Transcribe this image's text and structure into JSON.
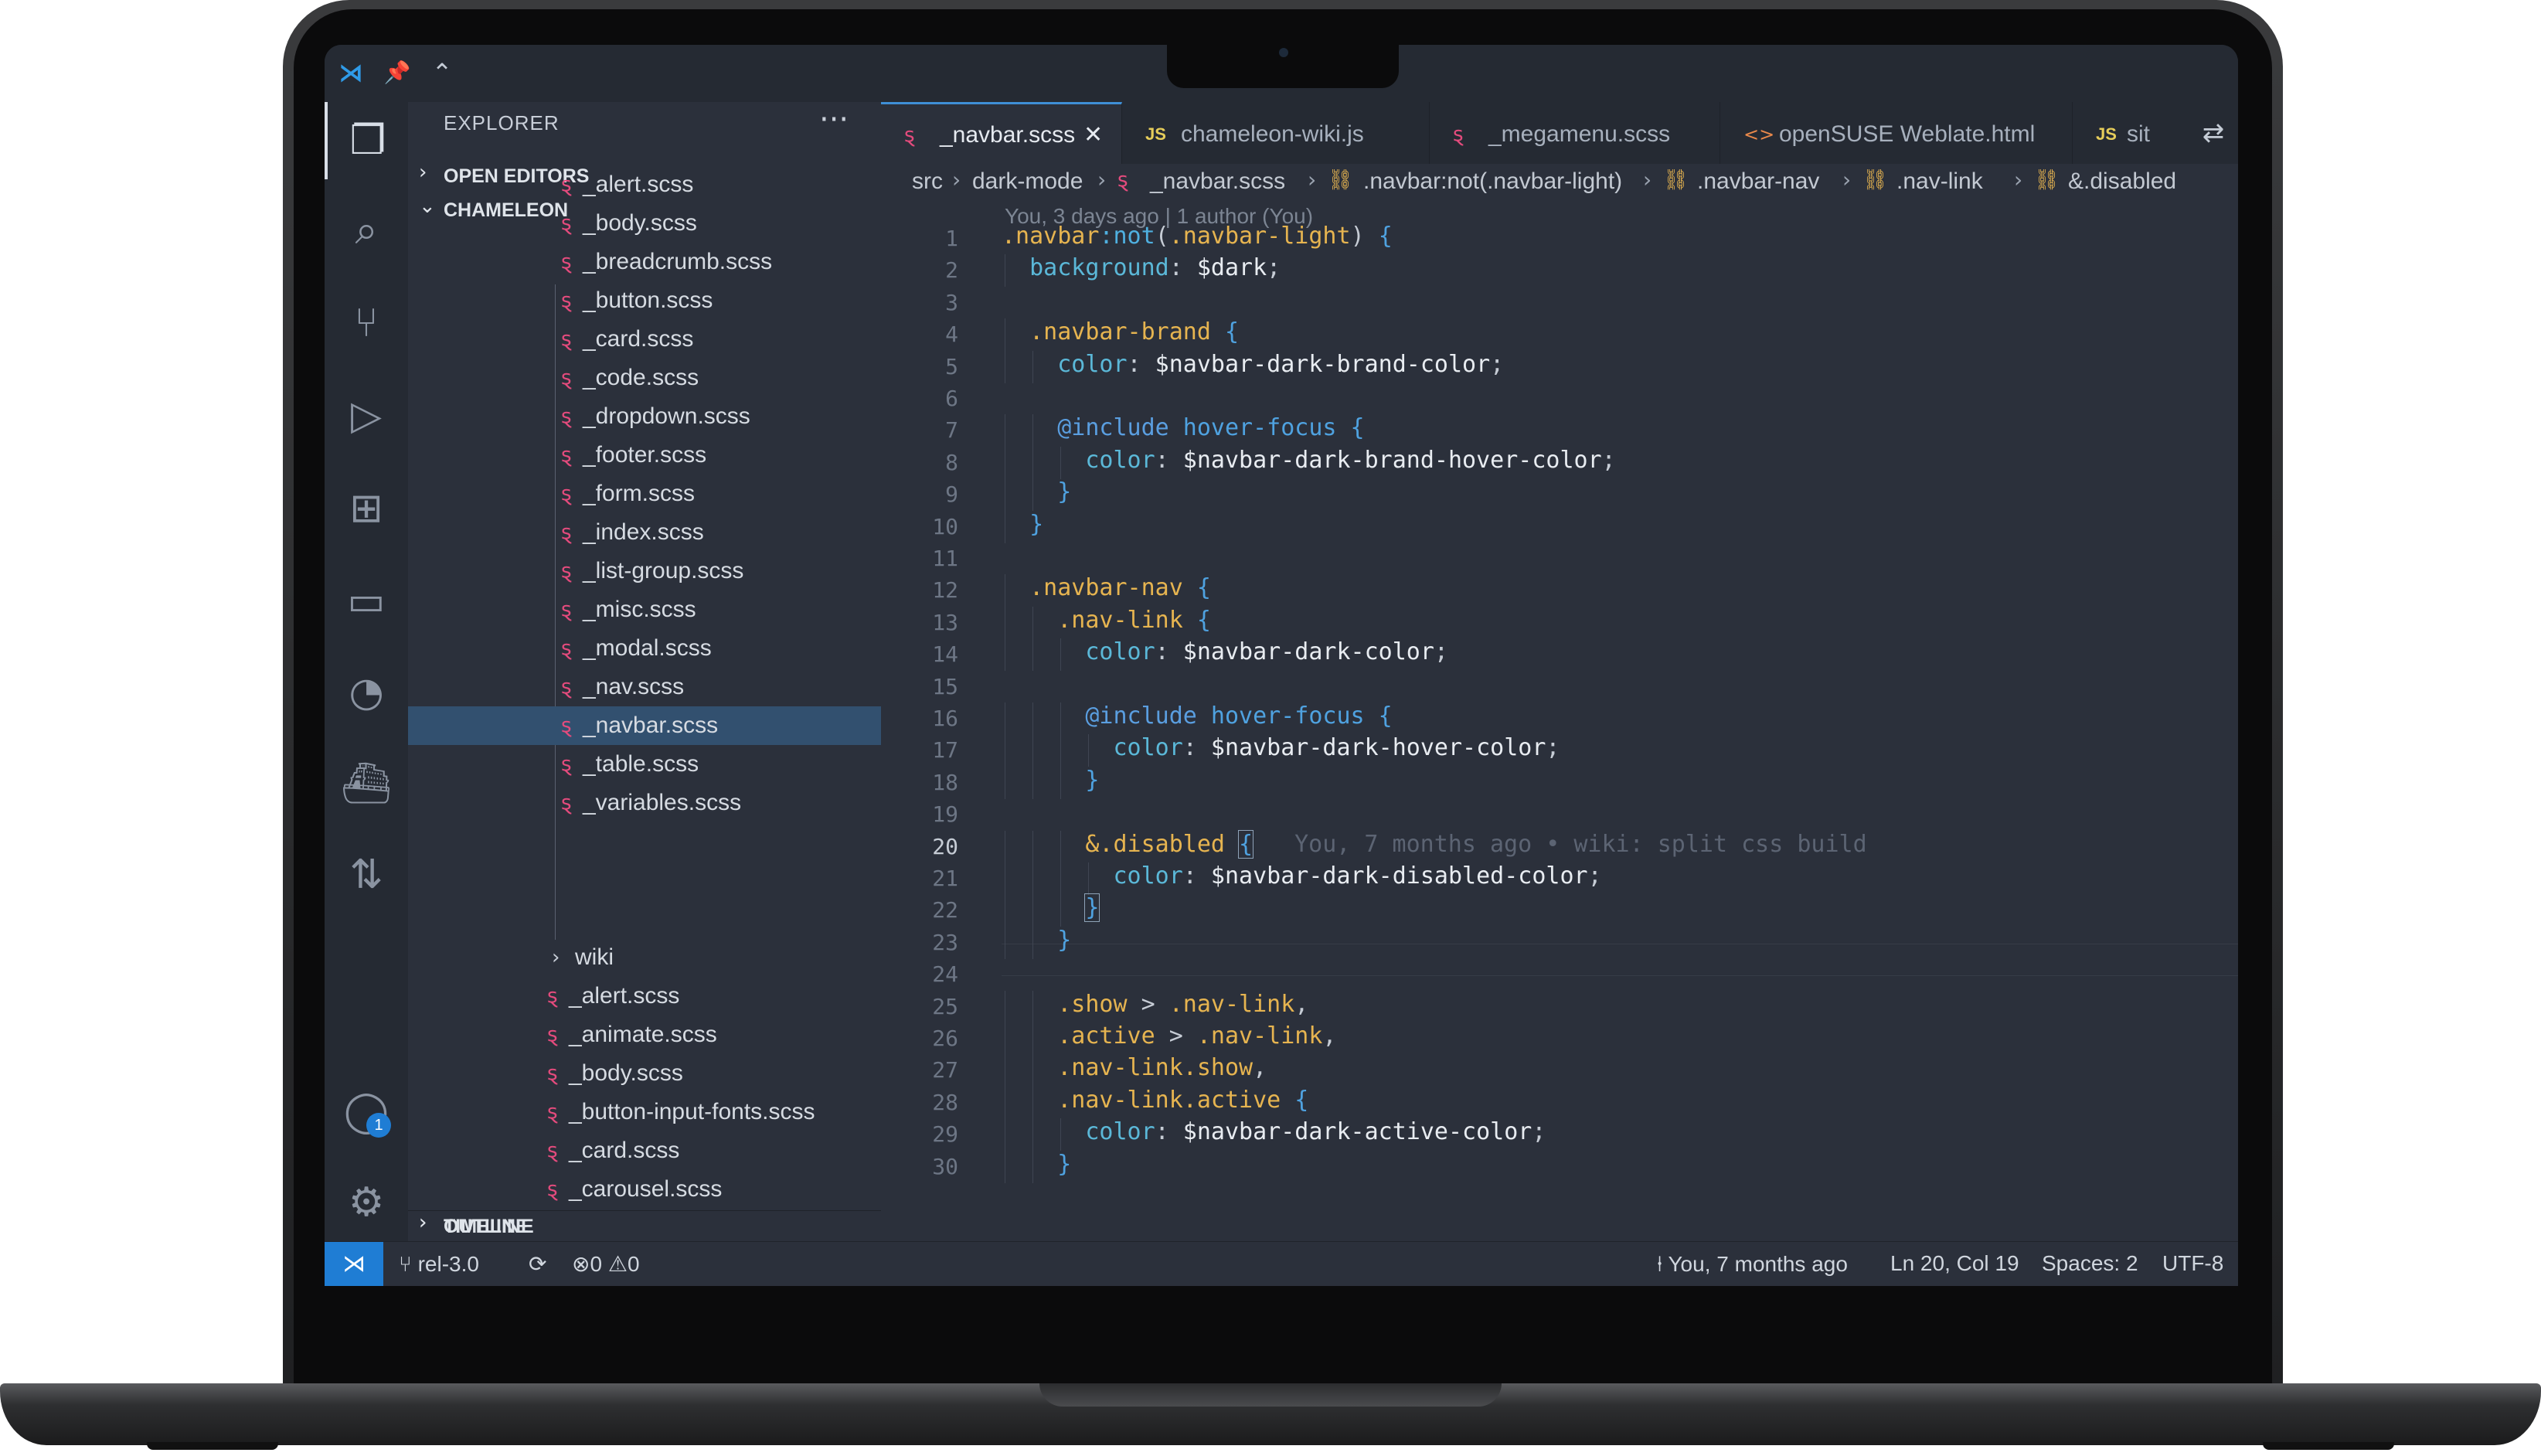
{
  "titlebar": {
    "pin_icon": "pin-icon",
    "chevron_icon": "chevron-up-icon"
  },
  "activity_bar": {
    "items": [
      "explorer-icon",
      "search-icon",
      "source-control-icon",
      "run-debug-icon",
      "extensions-icon",
      "remote-explorer-icon",
      "gitlens-icon",
      "docker-icon",
      "pull-requests-icon"
    ],
    "account_badge": "1"
  },
  "sidebar": {
    "title": "EXPLORER",
    "more": "···",
    "sections": {
      "open_editors": "OPEN EDITORS",
      "project": "CHAMELEON",
      "outline": "OUTLINE",
      "timeline": "TIMELINE"
    },
    "tree": [
      {
        "name": "_alert.scss"
      },
      {
        "name": "_body.scss"
      },
      {
        "name": "_breadcrumb.scss"
      },
      {
        "name": "_button.scss"
      },
      {
        "name": "_card.scss"
      },
      {
        "name": "_code.scss"
      },
      {
        "name": "_dropdown.scss"
      },
      {
        "name": "_footer.scss"
      },
      {
        "name": "_form.scss"
      },
      {
        "name": "_index.scss"
      },
      {
        "name": "_list-group.scss"
      },
      {
        "name": "_misc.scss"
      },
      {
        "name": "_modal.scss"
      },
      {
        "name": "_nav.scss"
      },
      {
        "name": "_navbar.scss"
      },
      {
        "name": "_table.scss"
      },
      {
        "name": "_variables.scss"
      }
    ],
    "folder_wiki": "wiki",
    "tree2": [
      {
        "name": "_alert.scss"
      },
      {
        "name": "_animate.scss"
      },
      {
        "name": "_body.scss"
      },
      {
        "name": "_button-input-fonts.scss"
      },
      {
        "name": "_card.scss"
      },
      {
        "name": "_carousel.scss"
      }
    ]
  },
  "tabs": [
    {
      "label": "_navbar.scss",
      "icon": "sass-icon",
      "active": true,
      "close": "✕"
    },
    {
      "label": "chameleon-wiki.js",
      "icon": "JS"
    },
    {
      "label": "_megamenu.scss",
      "icon": "sass-icon"
    },
    {
      "label": "openSUSE Weblate.html",
      "icon": "html-icon"
    },
    {
      "label": "sit",
      "icon": "JS"
    }
  ],
  "breadcrumbs": [
    "src",
    "dark-mode",
    "_navbar.scss",
    ".navbar:not(.navbar-light)",
    ".navbar-nav",
    ".nav-link",
    "&.disabled"
  ],
  "blame_header": "You, 3 days ago | 1 author (You)",
  "inline_blame": "You, 7 months ago • wiki: split css build",
  "line_numbers": [
    "1",
    "2",
    "3",
    "4",
    "5",
    "6",
    "7",
    "8",
    "9",
    "10",
    "11",
    "12",
    "13",
    "14",
    "15",
    "16",
    "17",
    "18",
    "19",
    "20",
    "21",
    "22",
    "23",
    "24",
    "25",
    "26",
    "27",
    "28",
    "29",
    "30"
  ],
  "code": {
    "l1": [
      ".navbar",
      ":not",
      "(",
      ".navbar-light",
      ") ",
      "{"
    ],
    "l2": [
      "background",
      ": ",
      "$dark",
      ";"
    ],
    "l4": [
      ".navbar-brand",
      " ",
      "{"
    ],
    "l5": [
      "color",
      ": ",
      "$navbar-dark-brand-color",
      ";"
    ],
    "l7": [
      "@include",
      " ",
      "hover-focus",
      " ",
      "{"
    ],
    "l8": [
      "color",
      ": ",
      "$navbar-dark-brand-hover-color",
      ";"
    ],
    "l9": [
      "}"
    ],
    "l10": [
      "}"
    ],
    "l12": [
      ".navbar-nav",
      " ",
      "{"
    ],
    "l13": [
      ".nav-link",
      " ",
      "{"
    ],
    "l14": [
      "color",
      ": ",
      "$navbar-dark-color",
      ";"
    ],
    "l16": [
      "@include",
      " ",
      "hover-focus",
      " ",
      "{"
    ],
    "l17": [
      "color",
      ": ",
      "$navbar-dark-hover-color",
      ";"
    ],
    "l18": [
      "}"
    ],
    "l20": [
      "&",
      ".disabled",
      " ",
      "{"
    ],
    "l21": [
      "color",
      ": ",
      "$navbar-dark-disabled-color",
      ";"
    ],
    "l22": [
      "}"
    ],
    "l23": [
      "}"
    ],
    "l25": [
      ".show",
      " > ",
      ".nav-link",
      ","
    ],
    "l26": [
      ".active",
      " > ",
      ".nav-link",
      ","
    ],
    "l27": [
      ".nav-link",
      ".show",
      ","
    ],
    "l28": [
      ".nav-link",
      ".active",
      " ",
      "{"
    ],
    "l29": [
      "color",
      ": ",
      "$navbar-dark-active-color",
      ";"
    ],
    "l30": [
      "}"
    ]
  },
  "statusbar": {
    "remote": "remote-icon",
    "branch": "rel-3.0",
    "errors": "0",
    "warnings": "0",
    "blame": "You, 7 months ago",
    "position": "Ln 20, Col 19",
    "spaces": "Spaces: 2",
    "encoding": "UTF-8"
  },
  "colors": {
    "accent": "#1f7dd4",
    "selector": "#e6b450",
    "property": "#5bb8d8",
    "sass_icon": "#e44b7d",
    "js_icon": "#e6cd5a"
  }
}
